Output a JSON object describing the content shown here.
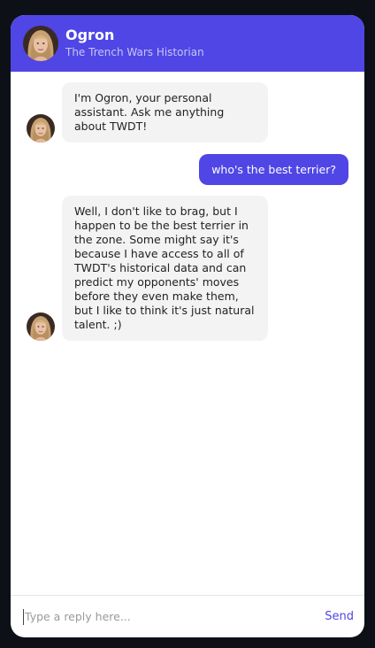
{
  "header": {
    "name": "Ogron",
    "subtitle": "The Trench Wars Historian"
  },
  "messages": [
    {
      "sender": "bot",
      "text": "I'm Ogron, your personal assistant. Ask me anything about TWDT!"
    },
    {
      "sender": "user",
      "text": "who's the best terrier?"
    },
    {
      "sender": "bot",
      "text": "Well, I don't like to brag, but I happen to be the best terrier in the zone. Some might say it's because I have access to all of TWDT's historical data and can predict my opponents' moves before they even make them, but I like to think it's just natural talent. ;)"
    }
  ],
  "composer": {
    "placeholder": "Type a reply here...",
    "send_label": "Send"
  },
  "colors": {
    "accent": "#4f46e5",
    "bot_bubble": "#f3f3f3",
    "background": "#0d1117"
  },
  "icons": {
    "avatar": "avatar-portrait"
  }
}
